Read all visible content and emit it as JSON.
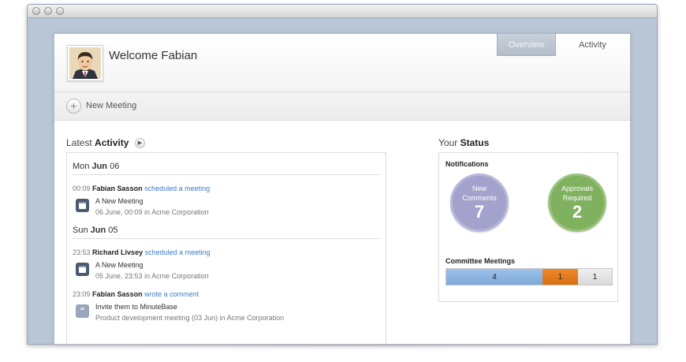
{
  "header": {
    "welcome": "Welcome Fabian",
    "tabs": [
      {
        "label": "Overview",
        "active": true
      },
      {
        "label": "Activity",
        "active": false
      }
    ]
  },
  "toolbar": {
    "new_meeting_label": "New Meeting"
  },
  "activity": {
    "title_prefix": "Latest",
    "title_strong": "Activity",
    "days": [
      {
        "prefix": "Mon",
        "month": "Jun",
        "date": "06",
        "events": [
          {
            "time": "00:09",
            "user": "Fabian Sasson",
            "action": "scheduled a meeting",
            "icon": "calendar-icon",
            "title": "A New Meeting",
            "detail": "06 June, 00:09",
            "in_word": "in",
            "org": "Acme Corporation"
          }
        ]
      },
      {
        "prefix": "Sun",
        "month": "Jun",
        "date": "05",
        "events": [
          {
            "time": "23:53",
            "user": "Richard Livsey",
            "action": "scheduled a meeting",
            "icon": "calendar-icon",
            "title": "A New Meeting",
            "detail": "05 June, 23:53",
            "in_word": "in",
            "org": "Acme Corporation"
          },
          {
            "time": "23:09",
            "user": "Fabian Sasson",
            "action": "wrote a comment",
            "icon": "quote-icon",
            "title": "Invite them to MinuteBase",
            "detail": "Product development meeting (03 Jun)",
            "in_word": "in",
            "org": "Acme Corporation"
          }
        ]
      }
    ]
  },
  "status": {
    "title_prefix": "Your",
    "title_strong": "Status",
    "notifications_label": "Notifications",
    "new_comments": {
      "label_line1": "New",
      "label_line2": "Comments",
      "count": "7",
      "color": "#a3a2cc"
    },
    "approvals": {
      "label_line1": "Approvals",
      "label_line2": "Required",
      "count": "2",
      "color": "#7fb15f"
    },
    "committee_label": "Committee Meetings",
    "committee_segments": [
      {
        "value": "4",
        "color": "#8fb6e0"
      },
      {
        "value": "1",
        "color": "#e07d20"
      },
      {
        "value": "1",
        "color": "#e4e4e4"
      }
    ]
  }
}
